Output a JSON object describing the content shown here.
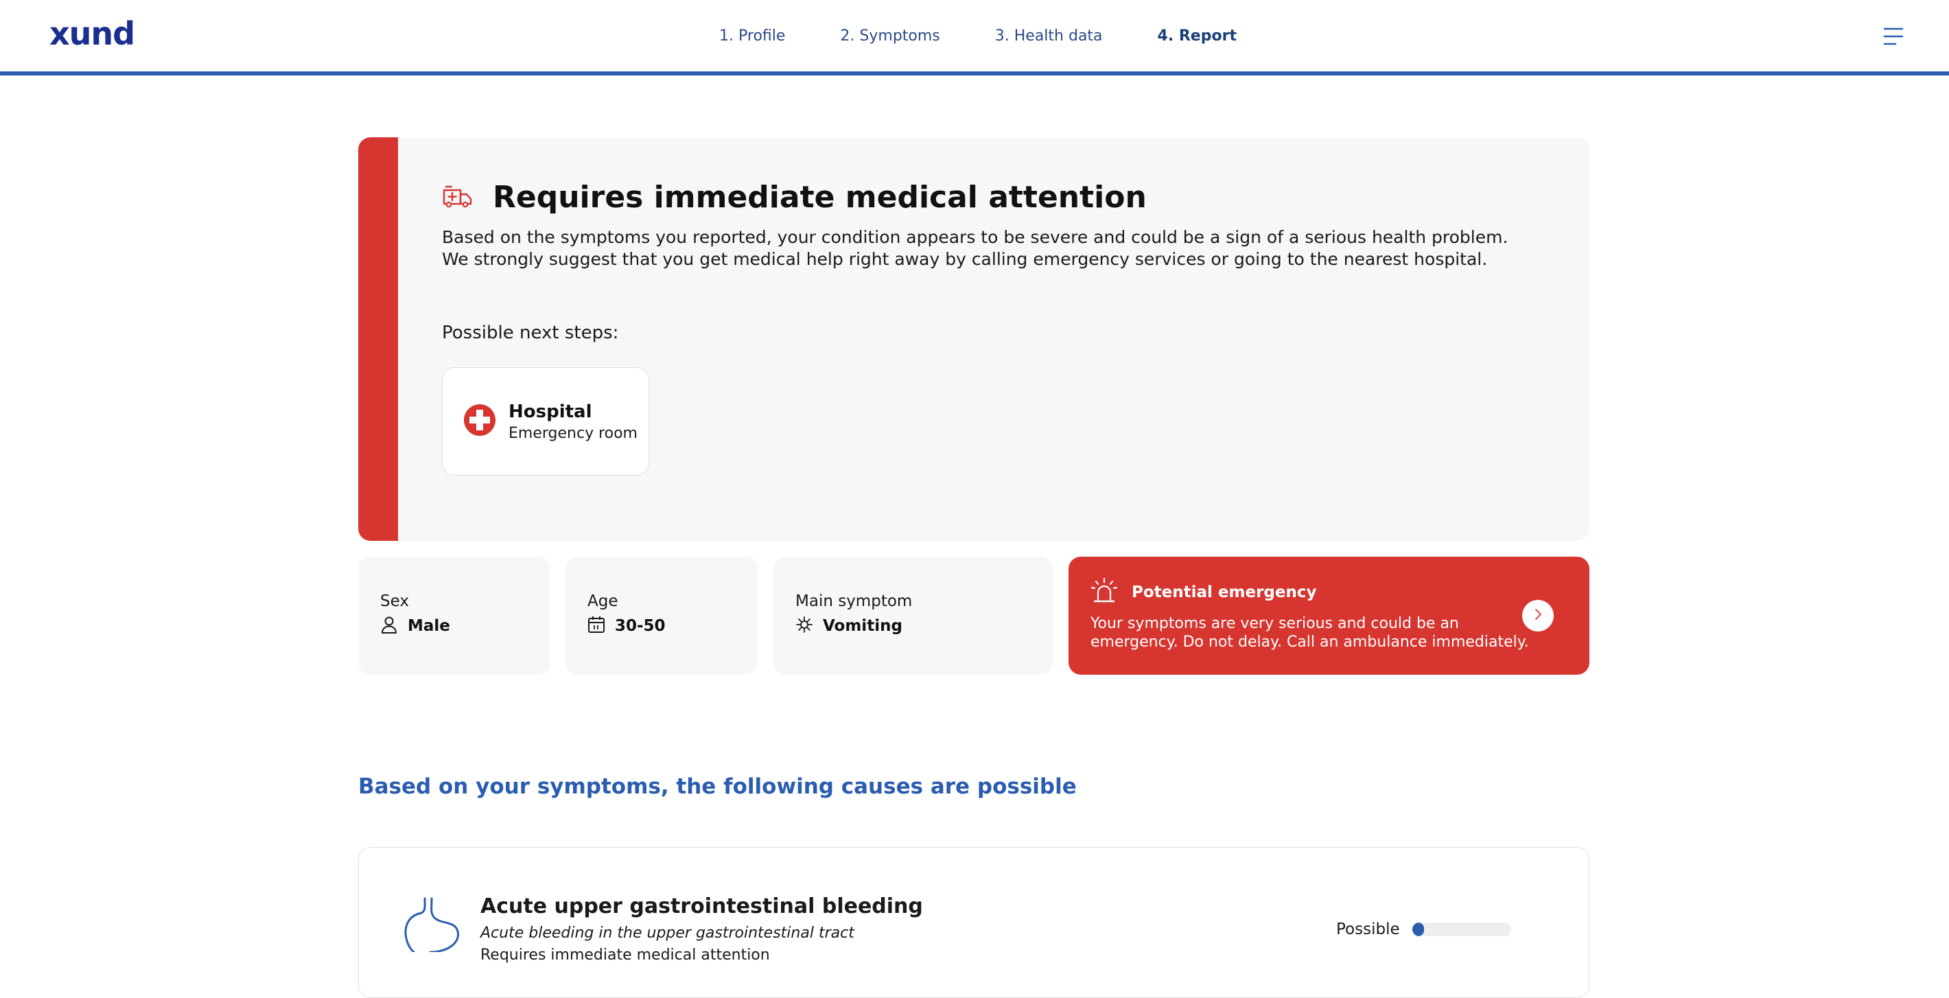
{
  "header": {
    "logo": "xund",
    "nav": [
      {
        "label": "1. Profile",
        "active": false
      },
      {
        "label": "2. Symptoms",
        "active": false
      },
      {
        "label": "3. Health data",
        "active": false
      },
      {
        "label": "4. Report",
        "active": true
      }
    ],
    "menu_icon": "hamburger-menu-icon"
  },
  "alert": {
    "icon": "ambulance-icon",
    "title": "Requires immediate medical attention",
    "description": "Based on the symptoms you reported, your condition appears to be severe and could be a sign of a serious health problem. We strongly suggest that you get medical help right away by calling emergency services or going to the nearest hospital.",
    "next_steps_label": "Possible next steps:",
    "next_step": {
      "icon": "medical-cross-icon",
      "name": "Hospital",
      "sub": "Emergency room"
    }
  },
  "profile": {
    "sex": {
      "label": "Sex",
      "value": "Male",
      "icon": "person-icon"
    },
    "age": {
      "label": "Age",
      "value": "30-50",
      "icon": "calendar-icon"
    },
    "main_symptom": {
      "label": "Main symptom",
      "value": "Vomiting",
      "icon": "virus-icon"
    }
  },
  "emergency": {
    "icon": "siren-icon",
    "title": "Potential emergency",
    "text": "Your symptoms are very serious and could be an emergency. Do not delay. Call an ambulance immediately.",
    "arrow_icon": "chevron-right-icon"
  },
  "causes": {
    "heading": "Based on your symptoms, the following causes are possible",
    "items": [
      {
        "icon": "stomach-icon",
        "name": "Acute upper gastrointestinal bleeding",
        "description": "Acute bleeding in the upper gastrointestinal tract",
        "extra": "Requires immediate medical attention",
        "likelihood_label": "Possible",
        "likelihood": 0.12
      }
    ]
  },
  "colors": {
    "brand_blue": "#2a5db0",
    "logo_navy": "#1b2f8f",
    "alert_red": "#d63530",
    "panel_gray": "#f7f7f7"
  }
}
